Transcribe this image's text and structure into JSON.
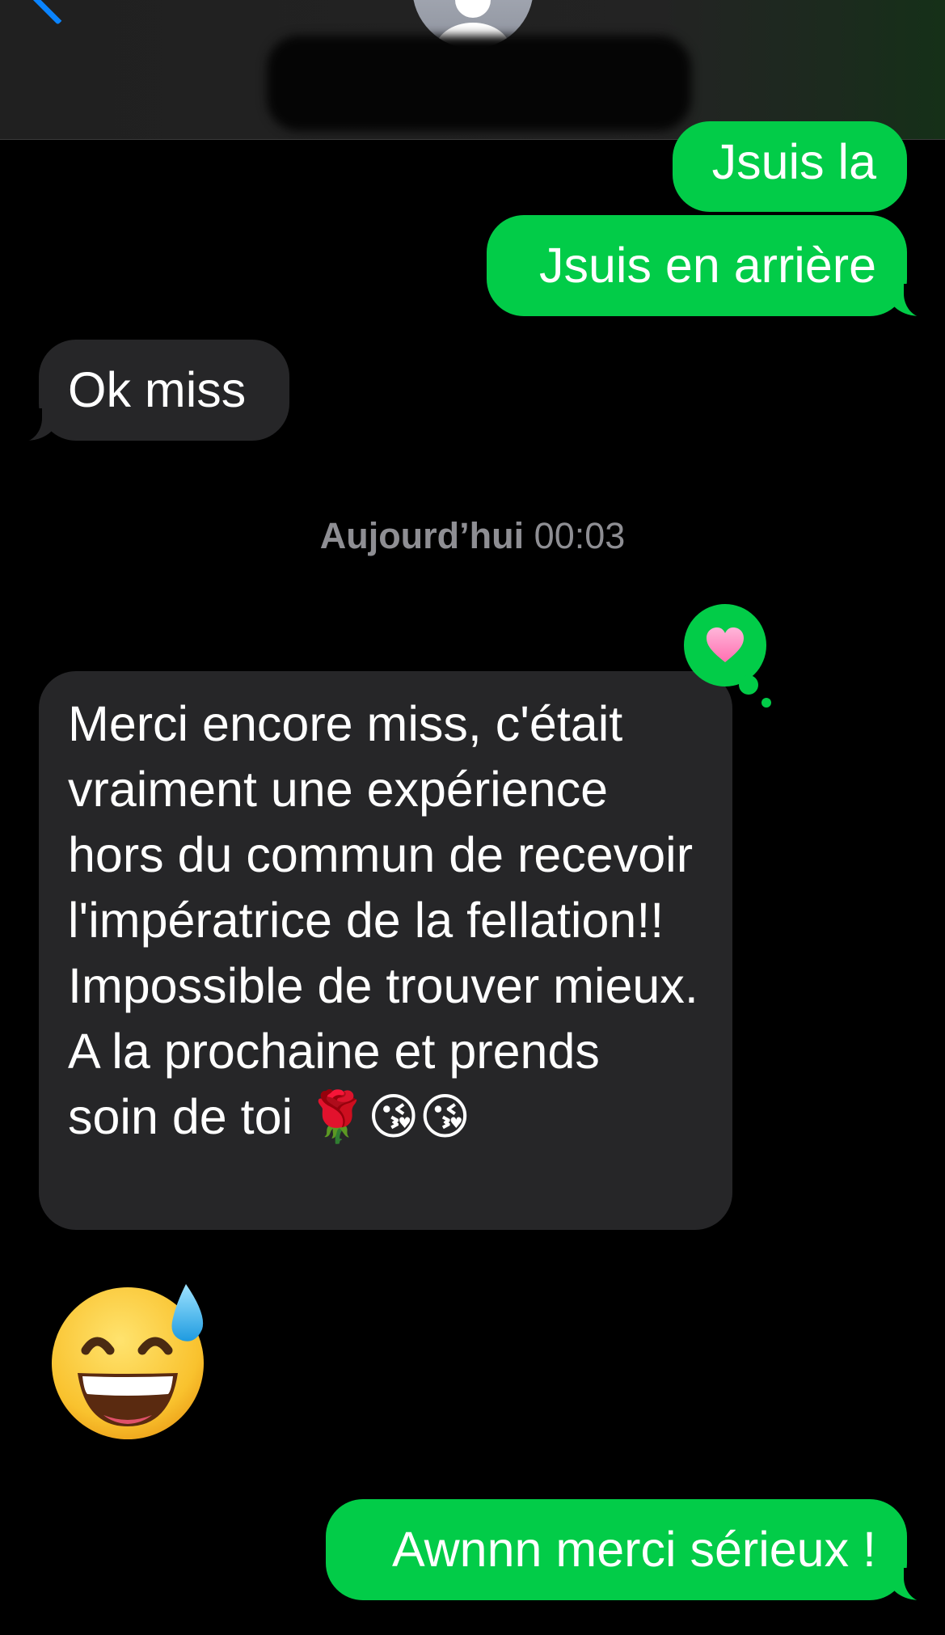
{
  "header": {
    "back_icon": "chevron-left-icon",
    "avatar_icon": "person-silhouette-icon",
    "name_redacted": true
  },
  "messages": [
    {
      "id": "msg1",
      "direction": "sent",
      "text": "Jsuis la"
    },
    {
      "id": "msg2",
      "direction": "sent",
      "text": "Jsuis en arrière"
    },
    {
      "id": "msg3",
      "direction": "received",
      "text": "Ok miss"
    },
    {
      "id": "msg4",
      "direction": "received",
      "text": "Merci encore miss, c'était vraiment une expérience hors du commun de recevoir l'impératrice de la fellation!! Impossible de trouver mieux. A la prochaine et prends soin de toi 🌹😘😘",
      "tapback": "heart-icon"
    },
    {
      "id": "msg5",
      "direction": "sent",
      "text": "Awnnn merci sérieux !"
    }
  ],
  "timestamp": {
    "day": "Aujourd’hui",
    "time": "00:03"
  },
  "big_emoji": {
    "name": "grinning-face-with-sweat-emoji",
    "char": "😅"
  },
  "colors": {
    "background": "#000000",
    "sent_bubble": "#02cc48",
    "received_bubble": "#262628",
    "timestamp_text": "#8e8e93",
    "back_chevron": "#0a84ff"
  }
}
